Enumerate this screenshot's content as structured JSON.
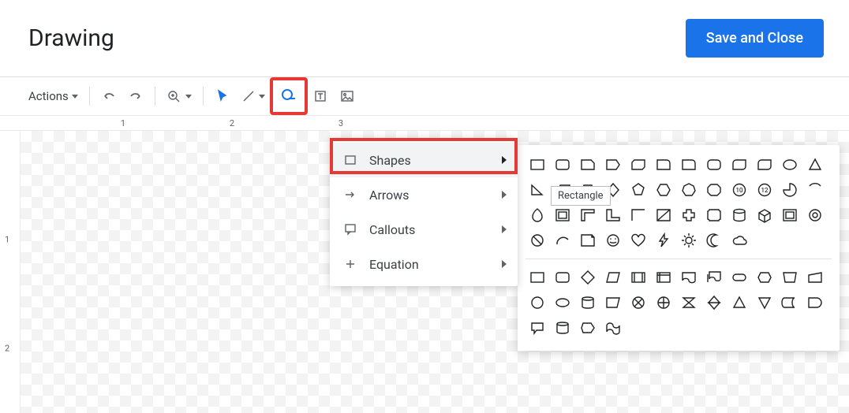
{
  "header": {
    "title": "Drawing",
    "save_label": "Save and Close"
  },
  "toolbar": {
    "actions_label": "Actions"
  },
  "ruler": {
    "h": [
      "1",
      "2",
      "3"
    ],
    "v": [
      "1",
      "2"
    ]
  },
  "shape_menu": {
    "items": [
      {
        "label": "Shapes",
        "icon": "rectangle-icon"
      },
      {
        "label": "Arrows",
        "icon": "arrow-right-icon"
      },
      {
        "label": "Callouts",
        "icon": "callout-icon"
      },
      {
        "label": "Equation",
        "icon": "plus-icon"
      }
    ]
  },
  "tooltip": {
    "text": "Rectangle"
  },
  "shapes_panel": {
    "group1": [
      "rectangle",
      "rounded-rectangle",
      "snip-corner",
      "home-plate",
      "snip-diagonal",
      "snip-round",
      "round-single",
      "round-same",
      "round-diagonal",
      "round-opposite",
      "oval",
      "triangle",
      "right-triangle",
      "parallelogram",
      "trapezoid",
      "diamond",
      "pentagon",
      "hexagon",
      "heptagon",
      "octagon",
      "decagon",
      "dodecagon",
      "pie",
      "chord",
      "teardrop",
      "frame",
      "half-frame",
      "l-shape",
      "corner",
      "diagonal-stripe",
      "cross",
      "plaque",
      "can",
      "cube",
      "bevel",
      "donut",
      "no-symbol",
      "arc",
      "folded-corner",
      "smiley",
      "heart",
      "lightning",
      "sun",
      "moon",
      "cloud"
    ],
    "group2": [
      "rect",
      "round-rect",
      "diamond-flow",
      "parallelogram-flow",
      "predefined",
      "internal-storage",
      "document",
      "multidocument",
      "terminator",
      "hexagon-flow",
      "trapezoid-flow",
      "manual-input",
      "circle",
      "oval-flow",
      "drum",
      "data",
      "summing",
      "or",
      "collate",
      "sort",
      "extract",
      "merge",
      "stored",
      "delay",
      "callout-round",
      "disk",
      "display",
      "tape"
    ]
  }
}
